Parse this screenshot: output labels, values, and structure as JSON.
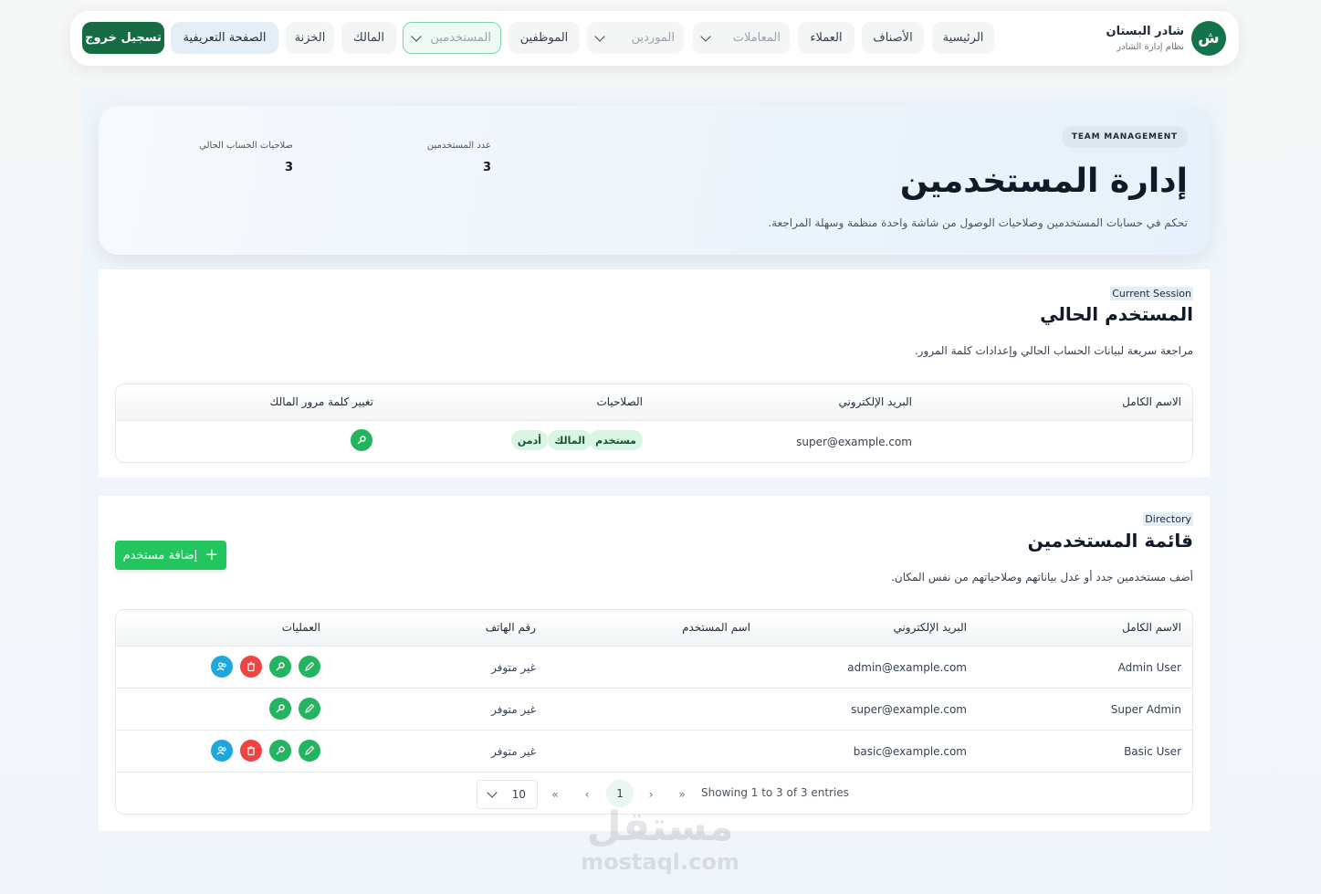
{
  "brand": {
    "logo_letter": "ش",
    "name": "شادر البستان",
    "subtitle": "نظام إدارة الشادر"
  },
  "nav": {
    "home": "الرئيسية",
    "categories": "الأصناف",
    "customers": "العملاء",
    "transactions": "المعاملات",
    "suppliers": "الموردين",
    "employees": "الموظفين",
    "users": "المستخدمين",
    "owner": "المالك",
    "treasury": "الخزنة",
    "profile": "الصفحة التعريفية",
    "logout": "تسجيل خروج"
  },
  "hero": {
    "badge": "TEAM MANAGEMENT",
    "title": "إدارة المستخدمين",
    "description": "تحكم في حسابات المستخدمين وصلاحيات الوصول من شاشة واحدة منظمة وسهلة المراجعة.",
    "stats": [
      {
        "label": "عدد المستخدمين",
        "value": "3"
      },
      {
        "label": "صلاحيات الحساب الحالي",
        "value": "3"
      }
    ]
  },
  "current_session": {
    "tag": "Current Session",
    "title": "المستخدم الحالي",
    "description": "مراجعة سريعة لبيانات الحساب الحالي وإعدادات كلمة المرور.",
    "columns": [
      "الاسم الكامل",
      "البريد الإلكتروني",
      "الصلاحيات",
      "تغيير كلمة مرور المالك"
    ],
    "row": {
      "full_name": "",
      "email": "super@example.com",
      "roles": [
        "مستخدم",
        "المالك",
        "أدمن"
      ]
    }
  },
  "directory": {
    "tag": "Directory",
    "title": "قائمة المستخدمين",
    "description": "أضف مستخدمين جدد أو عدل بياناتهم وصلاحياتهم من نفس المكان.",
    "add_button": "إضافة مستخدم",
    "columns": [
      "الاسم الكامل",
      "البريد الإلكتروني",
      "اسم المستخدم",
      "رقم الهاتف",
      "العمليات"
    ],
    "rows": [
      {
        "full_name": "Admin User",
        "email": "admin@example.com",
        "username": "",
        "phone": "غير متوفر",
        "actions": [
          "edit",
          "view",
          "delete",
          "roles"
        ]
      },
      {
        "full_name": "Super Admin",
        "email": "super@example.com",
        "username": "",
        "phone": "غير متوفر",
        "actions": [
          "edit",
          "view"
        ]
      },
      {
        "full_name": "Basic User",
        "email": "basic@example.com",
        "username": "",
        "phone": "غير متوفر",
        "actions": [
          "edit",
          "view",
          "delete",
          "roles"
        ]
      }
    ],
    "pagination": {
      "info": "Showing 1 to 3 of 3 entries",
      "current_page": "1",
      "page_size": "10",
      "first": "«",
      "prev": "‹",
      "next": "›",
      "last": "»"
    }
  },
  "watermark": {
    "arabic": "مستقل",
    "latin": "mostaql.com"
  },
  "colors": {
    "primary_dark_green": "#166b43",
    "accent_green": "#22c55e",
    "danger_red": "#ef4444",
    "info_blue": "#1ea7df",
    "chip_bg": "#d9f5e5"
  }
}
